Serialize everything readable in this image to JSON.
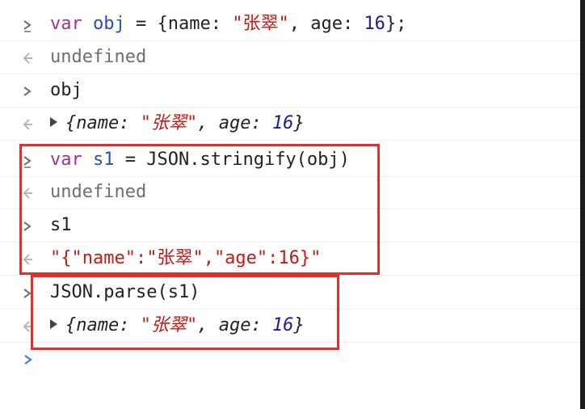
{
  "colors": {
    "keyword": "#a0338f",
    "variable": "#2a4fb0",
    "string": "#c41a16",
    "number": "#1a1aa6",
    "muted": "#6f6f6f",
    "highlight_box": "#e0302e",
    "active_prompt": "#3b78e7"
  },
  "icons": {
    "input": "chevron-right-icon",
    "output": "return-arrow-icon",
    "expand": "triangle-right-icon"
  },
  "console": {
    "entries": [
      {
        "kind": "input",
        "tokens": {
          "t1": "var",
          "t2": "obj",
          "t3": "=",
          "t4": "{name: ",
          "t5": "\"张翠\"",
          "t6": ", age: ",
          "t7": "16",
          "t8": "};"
        }
      },
      {
        "kind": "output",
        "text": "undefined"
      },
      {
        "kind": "input",
        "text": "obj"
      },
      {
        "kind": "output-object",
        "tokens": {
          "t1": "{name: ",
          "t2": "\"张翠\"",
          "t3": ", age: ",
          "t4": "16",
          "t5": "}"
        }
      },
      {
        "kind": "input",
        "tokens": {
          "t1": "var",
          "t2": "s1",
          "t3": "=",
          "t4": "JSON.stringify(obj)"
        }
      },
      {
        "kind": "output",
        "text": "undefined"
      },
      {
        "kind": "input",
        "text": "s1"
      },
      {
        "kind": "output-string",
        "text": "\"{\"name\":\"张翠\",\"age\":16}\""
      },
      {
        "kind": "input",
        "text": "JSON.parse(s1)"
      },
      {
        "kind": "output-object",
        "tokens": {
          "t1": "{name: ",
          "t2": "\"张翠\"",
          "t3": ", age: ",
          "t4": "16",
          "t5": "}"
        }
      }
    ]
  }
}
